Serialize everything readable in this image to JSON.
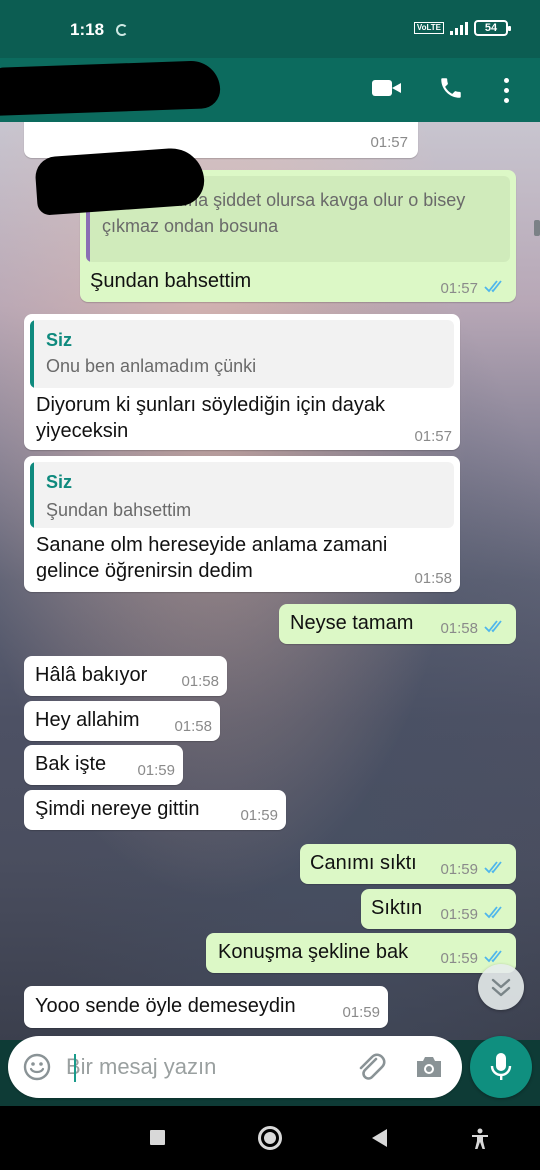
{
  "status_bar": {
    "time": "1:18",
    "network": "VoLTE",
    "battery": "54"
  },
  "colors": {
    "header": "#0c6b5e",
    "incoming_bubble": "#ffffff",
    "outgoing_bubble": "#dcf8c6",
    "read_ticks": "#4fb6ec",
    "accent": "#0f8f7f"
  },
  "header": {
    "contact_name_redacted": true,
    "icons": [
      "video-call-icon",
      "voice-call-icon",
      "more-options-icon"
    ]
  },
  "messages": [
    {
      "id": "m0",
      "dir": "in",
      "time": "01:57"
    },
    {
      "id": "m1",
      "dir": "out",
      "quote": {
        "author": "",
        "text": [
          "Kadın kadına şiddet olursa kavga olur o bisey",
          "çıkmaz ondan bosuna"
        ]
      },
      "text": [
        "Şundan bahsettim"
      ],
      "time": "01:57",
      "read": true
    },
    {
      "id": "m2",
      "dir": "in",
      "quote": {
        "author": "Siz",
        "text": [
          "Onu ben anlamadım çünki"
        ]
      },
      "text": [
        "Diyorum ki şunları söylediğin için dayak",
        "yiyeceksin"
      ],
      "time": "01:57"
    },
    {
      "id": "m3",
      "dir": "in",
      "quote": {
        "author": "Siz",
        "text": [
          "Şundan bahsettim"
        ]
      },
      "text": [
        "Sanane olm hereseyide anlama zamani",
        "gelince öğrenirsin dedim"
      ],
      "time": "01:58"
    },
    {
      "id": "m4",
      "dir": "out",
      "text": [
        "Neyse tamam"
      ],
      "time": "01:58",
      "read": true
    },
    {
      "id": "m5",
      "dir": "in",
      "text": [
        "Hâlâ bakıyor"
      ],
      "time": "01:58"
    },
    {
      "id": "m6",
      "dir": "in",
      "text": [
        "Hey allahim"
      ],
      "time": "01:58"
    },
    {
      "id": "m7",
      "dir": "in",
      "text": [
        "Bak işte"
      ],
      "time": "01:59"
    },
    {
      "id": "m8",
      "dir": "in",
      "text": [
        "Şimdi nereye gittin"
      ],
      "time": "01:59"
    },
    {
      "id": "m9",
      "dir": "out",
      "text": [
        "Canımı sıktı"
      ],
      "time": "01:59",
      "read": true
    },
    {
      "id": "m10",
      "dir": "out",
      "text": [
        "Sıktın"
      ],
      "time": "01:59",
      "read": true
    },
    {
      "id": "m11",
      "dir": "out",
      "text": [
        "Konuşma şekline bak"
      ],
      "time": "01:59",
      "read": true
    },
    {
      "id": "m12",
      "dir": "in",
      "text": [
        "Yooo sende öyle demeseydin"
      ],
      "time": "01:59"
    }
  ],
  "composer": {
    "placeholder": "Bir mesaj yazın",
    "value": ""
  }
}
